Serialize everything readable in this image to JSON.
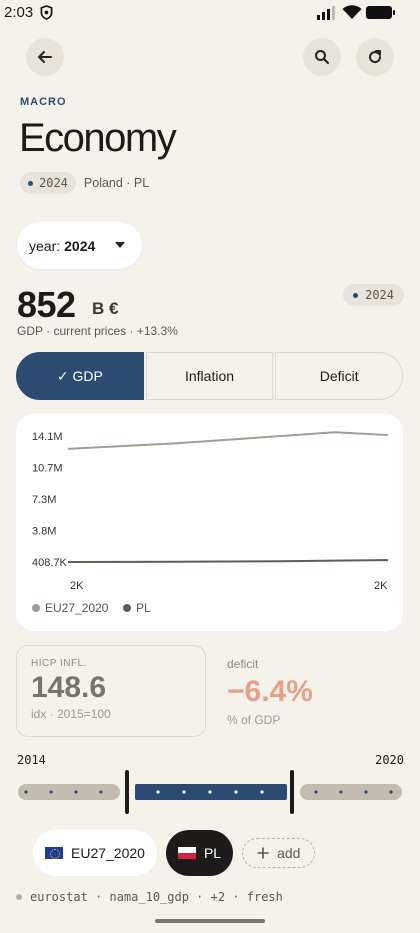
{
  "status": {
    "time": "2:03"
  },
  "header": {
    "eyebrow": "MACRO",
    "title": "Economy",
    "year_chip": "2024",
    "region": "Poland · PL"
  },
  "year_select": {
    "label": "year:",
    "value": "2024"
  },
  "headline": {
    "value": "852",
    "unit": "B €",
    "badge": "2024",
    "subline": "GDP · current prices · +13.3%"
  },
  "tabs": [
    {
      "label": "✓ GDP",
      "active": true
    },
    {
      "label": "Inflation",
      "active": false
    },
    {
      "label": "Deficit",
      "active": false
    }
  ],
  "chart_data": {
    "type": "line",
    "y_ticks": [
      "14.1M",
      "10.7M",
      "7.3M",
      "3.8M",
      "408.7K"
    ],
    "x_ticks": [
      "2K",
      "2K"
    ],
    "ylim": [
      408.7,
      14100
    ],
    "legend": [
      "EU27_2020",
      "PL"
    ],
    "legend_placement": "bottom-left",
    "series": [
      {
        "name": "EU27_2020",
        "color": "#a49d91",
        "values": [
          12700,
          13000,
          13300,
          13700,
          14100,
          14500,
          14200
        ]
      },
      {
        "name": "PL",
        "color": "#5a6150",
        "values": [
          410,
          420,
          430,
          460,
          500,
          560,
          620
        ]
      }
    ]
  },
  "stats": {
    "left": {
      "label": "HICP INFL.",
      "value": "148.6",
      "sub": "idx · 2015=100"
    },
    "right": {
      "label": "deficit",
      "value": "−6.4%",
      "sub": "% of GDP"
    }
  },
  "range": {
    "start": "2014",
    "end": "2020"
  },
  "chips": [
    {
      "label": "EU27_2020"
    },
    {
      "label": "PL"
    },
    {
      "label": "add"
    }
  ],
  "footer": {
    "text": "eurostat · nama_10_gdp · +2 · fresh"
  },
  "colors": {
    "accent": "#2d4a73",
    "background": "#f5f2ec",
    "negative": "#e5a089"
  }
}
